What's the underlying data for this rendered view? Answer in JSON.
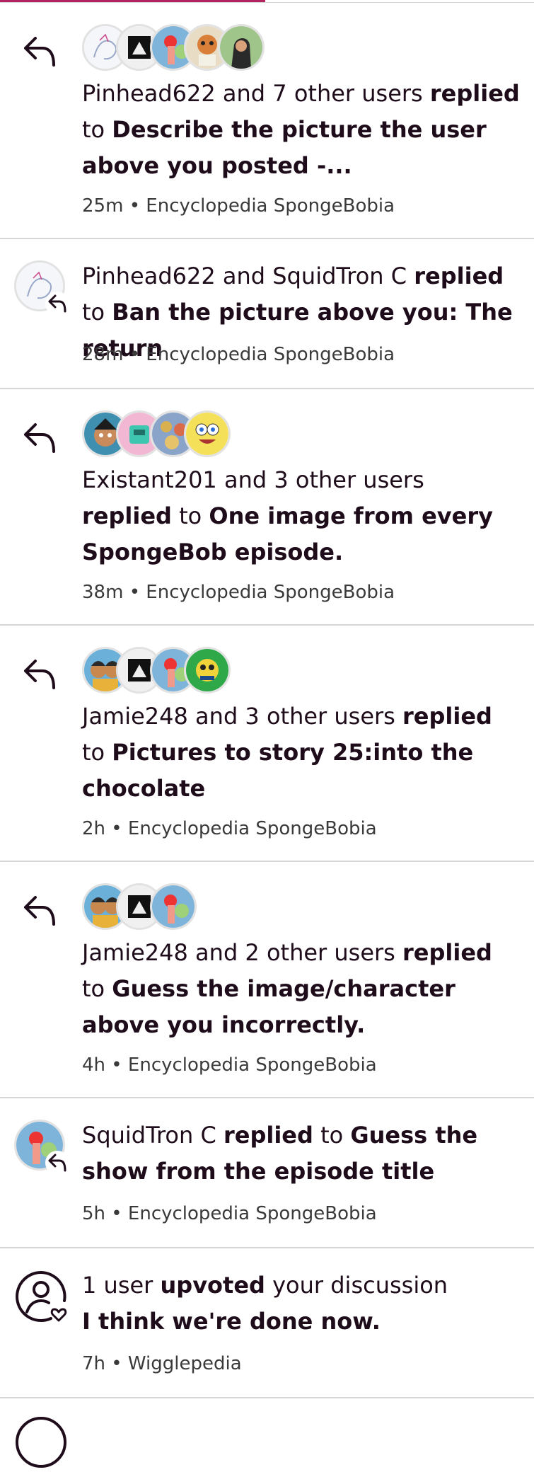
{
  "notifications": [
    {
      "type": "reply-group",
      "users_text": "Pinhead622 and 7 other users",
      "action": "replied",
      "connector": "to",
      "thread": "Describe the picture the user above you posted -...",
      "time": "25m",
      "wiki": "Encyclopedia SpongeBobia"
    },
    {
      "type": "reply-single",
      "users_text": "Pinhead622 and SquidTron C",
      "action": "replied",
      "connector": "to",
      "thread": "Ban the picture above you: The return",
      "time": "28m",
      "wiki": "Encyclopedia SpongeBobia"
    },
    {
      "type": "reply-group",
      "users_text": "Existant201 and 3 other users",
      "action": "replied",
      "connector": "to",
      "thread": "One image from every SpongeBob episode.",
      "time": "38m",
      "wiki": "Encyclopedia SpongeBobia"
    },
    {
      "type": "reply-group",
      "users_text": "Jamie248 and 3 other users",
      "action": "replied",
      "connector": "to",
      "thread": "Pictures to story 25:into the chocolate",
      "time": "2h",
      "wiki": "Encyclopedia SpongeBobia"
    },
    {
      "type": "reply-group",
      "users_text": "Jamie248 and 2 other users",
      "action": "replied",
      "connector": "to",
      "thread": "Guess the image/character above you incorrectly.",
      "time": "4h",
      "wiki": "Encyclopedia SpongeBobia"
    },
    {
      "type": "reply-single",
      "users_text": "SquidTron C",
      "action": "replied",
      "connector": "to",
      "thread": "Guess the show from the episode title",
      "time": "5h",
      "wiki": "Encyclopedia SpongeBobia"
    },
    {
      "type": "upvote",
      "users_text": "1 user",
      "action": "upvoted",
      "connector": "your discussion",
      "thread": "I think we're done now.",
      "time": "7h",
      "wiki": "Wigglepedia"
    }
  ],
  "separator": "•",
  "colors": {
    "accent": "#b3235f",
    "divider": "#d6d6d6",
    "text": "#1e0c1b"
  }
}
